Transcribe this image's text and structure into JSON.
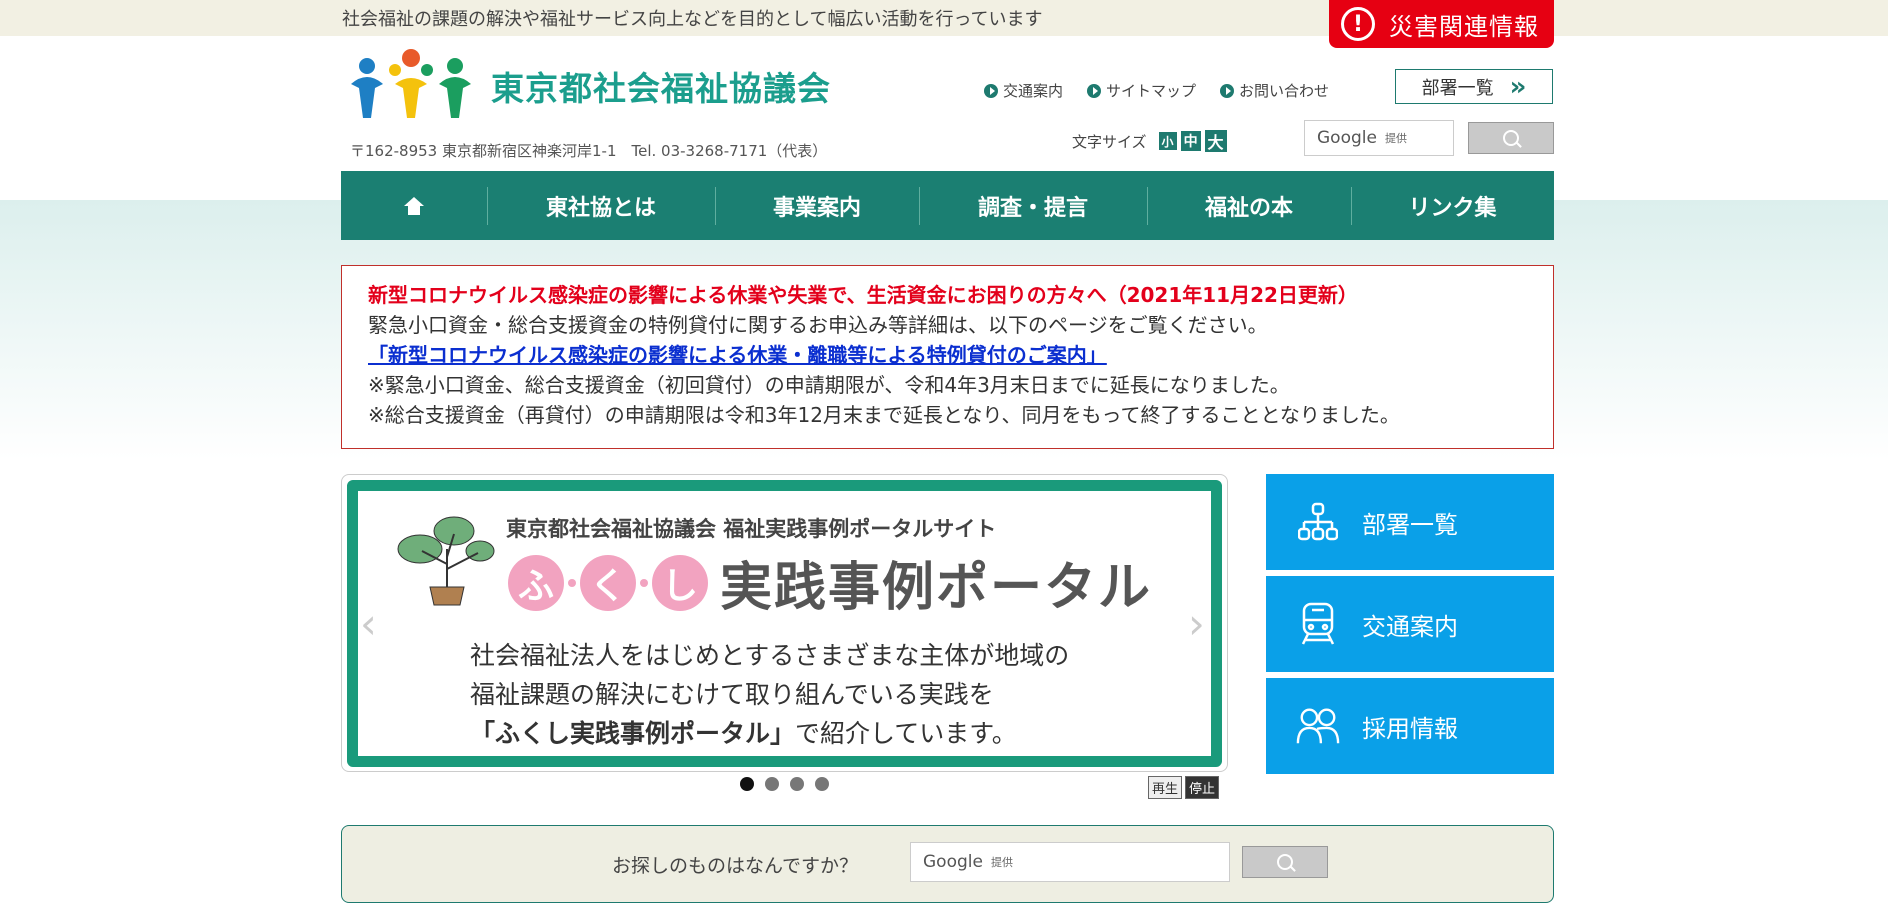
{
  "top_bar": {
    "tagline": "社会福祉の課題の解決や福祉サービス向上などを目的として幅広い活動を行っています",
    "disaster_label": "災害関連情報"
  },
  "header": {
    "org_name": "東京都社会福祉協議会",
    "address": "〒162-8953 東京都新宿区神楽河岸1-1　Tel. 03-3268-7171（代表）",
    "util_links": [
      "交通案内",
      "サイトマップ",
      "お問い合わせ"
    ],
    "dept_button": "部署一覧",
    "font_size_label": "文字サイズ",
    "font_sizes": [
      "小",
      "中",
      "大"
    ],
    "search_placeholder": "Google",
    "search_provided": "提供"
  },
  "nav": {
    "items": [
      "東社協とは",
      "事業案内",
      "調査・提言",
      "福祉の本",
      "リンク集"
    ]
  },
  "notice": {
    "title": "新型コロナウイルス感染症の影響による休業や失業で、生活資金にお困りの方々へ（2021年11月22日更新）",
    "line1": "緊急小口資金・総合支援資金の特例貸付に関するお申込み等詳細は、以下のページをご覧ください。",
    "link": "「新型コロナウイルス感染症の影響による休業・離職等による特例貸付のご案内」",
    "line2": "※緊急小口資金、総合支援資金（初回貸付）の申請期限が、令和4年3月末日までに延長になりました。",
    "line3": "※総合支援資金（再貸付）の申請期限は令和3年12月末まで延長となり、同月をもって終了することとなりました。"
  },
  "slider": {
    "subtitle": "東京都社会福祉協議会 福祉実践事例ポータルサイト",
    "kana": [
      "ふ",
      "く",
      "し"
    ],
    "title_main": "実践事例ポータル",
    "body1": "社会福祉法人をはじめとするさまざまな主体が地域の",
    "body2": "福祉課題の解決にむけて取り組んでいる実践を",
    "body3_bold": "「ふくし実践事例ポータル」",
    "body3_rest": "で紹介しています。",
    "prev": "‹",
    "next": "›",
    "play": "再生",
    "stop": "停止",
    "active_index": 0
  },
  "side_buttons": [
    "部署一覧",
    "交通案内",
    "採用情報"
  ],
  "bottom_search": {
    "prompt": "お探しのものはなんですか？",
    "placeholder": "Google",
    "provided": "提供"
  },
  "colors": {
    "brand_green": "#1b7f72",
    "alert_red": "#e60012",
    "side_blue": "#0aa0e8"
  }
}
